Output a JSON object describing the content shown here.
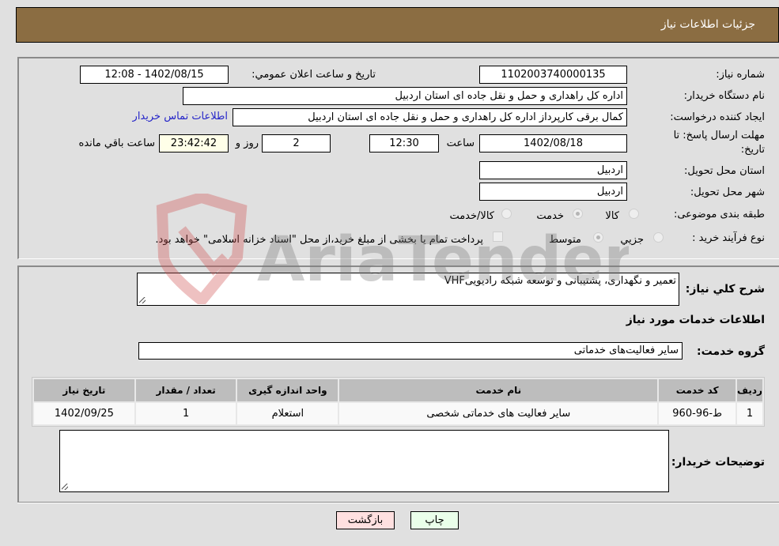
{
  "header": {
    "title": "جزئيات اطلاعات نیاز"
  },
  "form": {
    "need_number": {
      "label": "شماره نیاز:",
      "value": "1102003740000135"
    },
    "announce_datetime": {
      "label": "تاریخ و ساعت اعلان عمومي:",
      "value": "1402/08/15 - 12:08"
    },
    "buyer_org": {
      "label": "نام دستگاه خریدار:",
      "value": "اداره کل راهداری و حمل و نقل جاده ای استان اردبیل"
    },
    "requester": {
      "label": "ایجاد کننده درخواست:",
      "value": "کمال برقی کارپرداز اداره کل راهداری و حمل و نقل جاده ای استان اردبیل"
    },
    "contact_link": "اطلاعات تماس خریدار",
    "deadline": {
      "label_line1": "مهلت ارسال پاسخ: تا",
      "label_line2": "تاریخ:",
      "date": "1402/08/18",
      "time_label": "ساعت",
      "time": "12:30",
      "days": "2",
      "days_label": "روز و",
      "remaining": "23:42:42",
      "remaining_label": "ساعت باقي مانده"
    },
    "delivery_province": {
      "label": "استان محل تحویل:",
      "value": "اردبیل"
    },
    "delivery_city": {
      "label": "شهر محل تحویل:",
      "value": "اردبیل"
    },
    "category": {
      "label": "طبقه بندی موضوعی:",
      "options": [
        {
          "label": "کالا",
          "checked": false
        },
        {
          "label": "خدمت",
          "checked": true
        },
        {
          "label": "کالا/خدمت",
          "checked": false
        }
      ]
    },
    "purchase_type": {
      "label": "نوع فرآیند خرید :",
      "options": [
        {
          "label": "جزيي",
          "checked": false
        },
        {
          "label": "متوسط",
          "checked": true
        }
      ],
      "treasury_note": "پرداخت تمام یا بخشی از مبلغ خرید،از محل \"اسناد خزانه اسلامی\" خواهد بود."
    }
  },
  "details": {
    "description_label": "شرح کلي نیاز:",
    "description": "تعمیر و نگهداری، پشتیبانی و توسعه شبکه رادیوییVHF",
    "services_heading": "اطلاعات خدمات مورد نیاز",
    "service_group_label": "گروه خدمت:",
    "service_group": "سایر فعالیت‌های خدماتی",
    "table": {
      "headers": [
        "ردیف",
        "کد خدمت",
        "نام خدمت",
        "واحد اندازه گیری",
        "تعداد / مقدار",
        "تاریخ نیاز"
      ],
      "rows": [
        [
          "1",
          "ط-96-960",
          "سایر فعالیت های خدماتی شخصی",
          "استعلام",
          "1",
          "1402/09/25"
        ]
      ]
    },
    "buyer_notes_label": "توضیحات خریدار:",
    "buyer_notes": ""
  },
  "buttons": {
    "print": "چاپ",
    "back": "بازگشت"
  },
  "watermark": {
    "text": "AriaTender.neT"
  },
  "colors": {
    "header": "#8b6d42",
    "print_bg": "#eaffea",
    "back_bg": "#ffe0e0",
    "link": "#2424c8"
  }
}
